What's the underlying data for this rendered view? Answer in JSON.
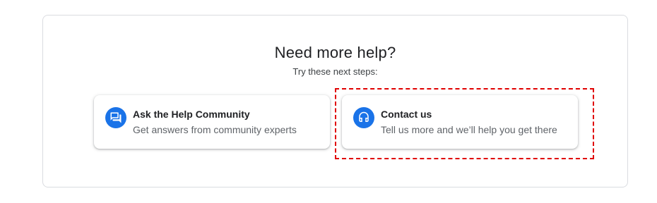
{
  "help": {
    "title": "Need more help?",
    "subtitle": "Try these next steps:"
  },
  "cards": [
    {
      "title": "Ask the Help Community",
      "description": "Get answers from community experts",
      "icon": "community-chat-icon"
    },
    {
      "title": "Contact us",
      "description": "Tell us more and we’ll help you get there",
      "icon": "headset-icon"
    }
  ],
  "colors": {
    "accent": "#1a73e8",
    "highlight": "#e00000",
    "border": "#dadce0",
    "title_text": "#202124",
    "secondary_text": "#5f6368"
  }
}
